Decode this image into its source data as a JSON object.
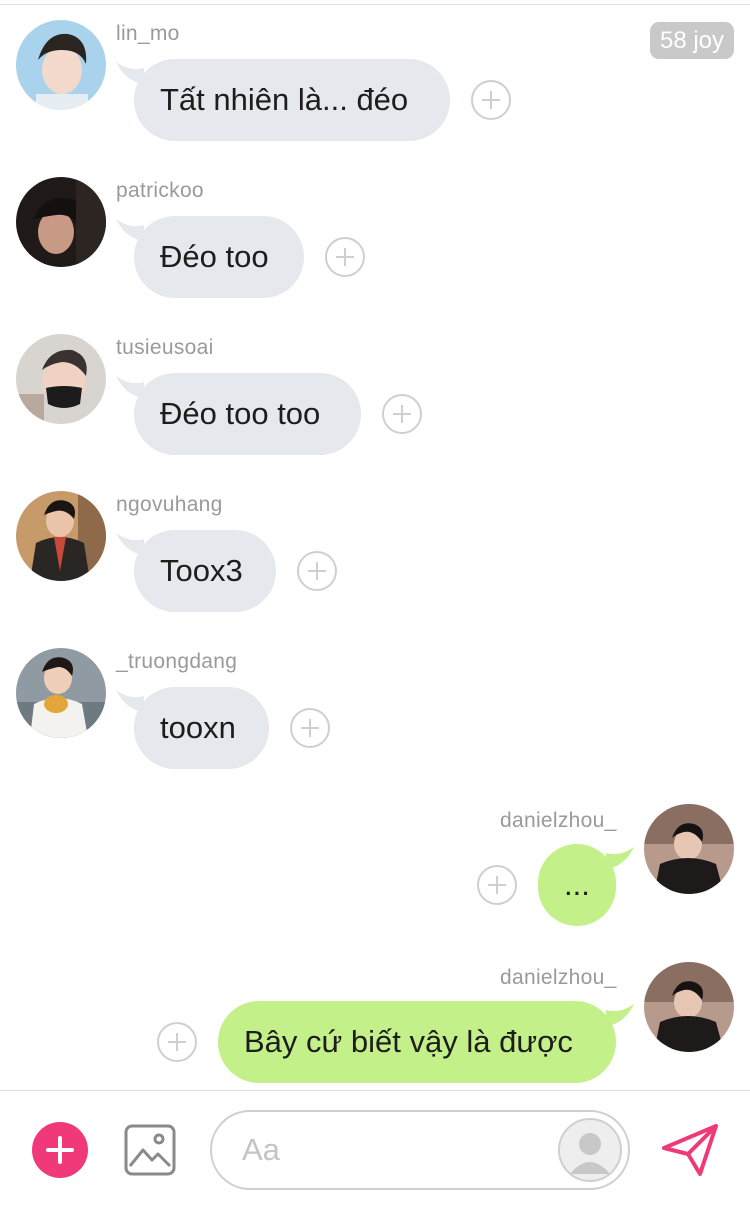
{
  "badge": {
    "label": "58 joy"
  },
  "messages": [
    {
      "username": "lin_mo",
      "text": "Tất nhiên là... đéo",
      "side": "in",
      "avatar": "avatar-photo"
    },
    {
      "username": "patrickoo",
      "text": "Đéo too",
      "side": "in",
      "avatar": "avatar-photo"
    },
    {
      "username": "tusieusoai",
      "text": "Đéo too too",
      "side": "in",
      "avatar": "avatar-photo"
    },
    {
      "username": "ngovuhang",
      "text": "Toox3",
      "side": "in",
      "avatar": "avatar-photo"
    },
    {
      "username": "_truongdang",
      "text": "tooxn",
      "side": "in",
      "avatar": "avatar-photo"
    },
    {
      "username": "danielzhou_",
      "text": "...",
      "side": "out",
      "avatar": "avatar-photo"
    },
    {
      "username": "danielzhou_",
      "text": "Bây cứ biết vậy là được",
      "side": "out",
      "avatar": "avatar-photo"
    }
  ],
  "composer": {
    "placeholder": "Aa",
    "add_icon": "plus-icon",
    "gallery_icon": "image-icon",
    "send_icon": "send-icon",
    "avatar_icon": "default-avatar-icon"
  },
  "colors": {
    "incoming_bubble": "#e5e8ec",
    "outgoing_bubble": "#c4f08a",
    "accent_pink": "#f0397b",
    "badge_bg": "#c9c9c9"
  }
}
